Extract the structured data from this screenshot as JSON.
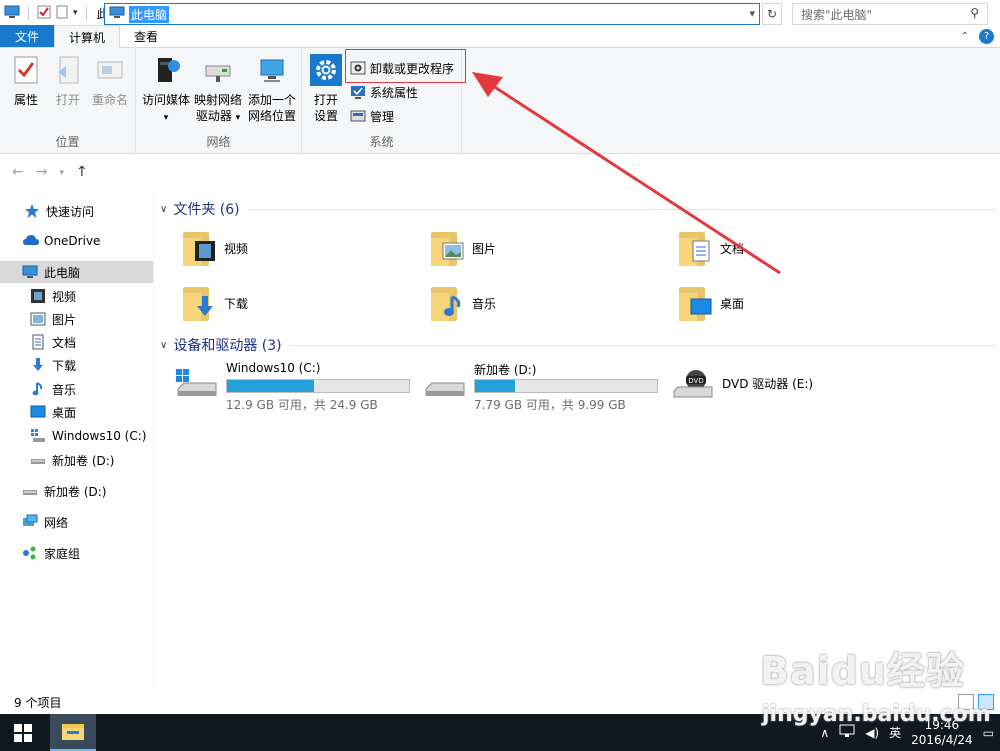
{
  "window": {
    "title": "此电脑",
    "controls": [
      "—",
      "❐",
      "✕"
    ]
  },
  "tabs": {
    "file": "文件",
    "computer": "计算机",
    "view": "查看"
  },
  "ribbon": {
    "location": {
      "label": "位置",
      "properties": "属性",
      "open": "打开",
      "rename": "重命名"
    },
    "network": {
      "label": "网络",
      "access_media": "访问媒体",
      "map_drive_1": "映射网络",
      "map_drive_2": "驱动器",
      "add_location_1": "添加一个",
      "add_location_2": "网络位置"
    },
    "system": {
      "label": "系统",
      "open_settings_1": "打开",
      "open_settings_2": "设置",
      "uninstall": "卸载或更改程序",
      "system_properties": "系统属性",
      "manage": "管理"
    }
  },
  "address": {
    "path": "此电脑",
    "search_placeholder": "搜索\"此电脑\""
  },
  "sidebar": {
    "quick_access": "快速访问",
    "onedrive": "OneDrive",
    "this_pc": "此电脑",
    "videos": "视频",
    "pictures": "图片",
    "documents": "文档",
    "downloads": "下载",
    "music": "音乐",
    "desktop": "桌面",
    "drive_c": "Windows10 (C:)",
    "drive_d_sub": "新加卷 (D:)",
    "drive_d": "新加卷 (D:)",
    "network": "网络",
    "homegroup": "家庭组"
  },
  "content": {
    "folders_header": "文件夹 (6)",
    "folders": [
      "视频",
      "图片",
      "文档",
      "下载",
      "音乐",
      "桌面"
    ],
    "devices_header": "设备和驱动器 (3)",
    "drives": [
      {
        "name": "Windows10 (C:)",
        "info": "12.9 GB 可用，共 24.9 GB",
        "used_fraction": 0.48
      },
      {
        "name": "新加卷 (D:)",
        "info": "7.79 GB 可用，共 9.99 GB",
        "used_fraction": 0.22
      },
      {
        "name": "DVD 驱动器 (E:)"
      }
    ]
  },
  "status": {
    "items": "9 个项目"
  },
  "taskbar": {
    "time": "19:46",
    "date": "2016/4/24",
    "ime": "英"
  },
  "watermark": {
    "brand": "Baidu经验",
    "url": "jingyan.baidu.com"
  },
  "colors": {
    "accent": "#1979ca",
    "highlight": "#e4393c",
    "drive_bar": "#26a0da"
  }
}
